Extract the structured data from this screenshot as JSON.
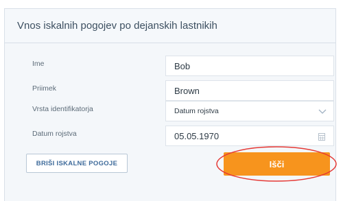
{
  "form": {
    "title": "Vnos iskalnih pogojev po dejanskih lastnikih",
    "first_name": {
      "label": "Ime",
      "value": "Bob"
    },
    "last_name": {
      "label": "Priimek",
      "value": "Brown"
    },
    "identifier_type": {
      "label": "Vrsta identifikatorja",
      "value": "Datum rojstva"
    },
    "birth_date": {
      "label": "Datum rojstva",
      "value": "05.05.1970"
    },
    "clear_button": "BRIŠI ISKALNE POGOJE",
    "search_button": "Išči"
  },
  "colors": {
    "accent": "#f7941d",
    "highlight_ring": "#e53935",
    "panel_bg": "#f4f7fa"
  },
  "icons": [
    "chevron-down-icon",
    "calendar-icon"
  ]
}
